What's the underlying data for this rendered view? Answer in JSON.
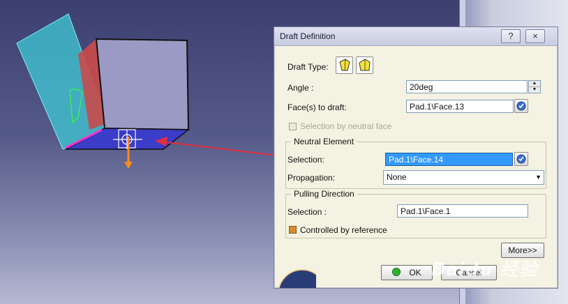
{
  "dialog": {
    "title": "Draft Definition",
    "help_label": "?",
    "close_label": "×",
    "draft_type_label": "Draft Type:",
    "angle_label": "Angle :",
    "angle_value": "20deg",
    "faces_label": "Face(s) to draft:",
    "faces_value": "Pad.1\\Face.13",
    "neutral_face_checkbox_label": "Selection by neutral face",
    "neutral_element": {
      "title": "Neutral Element",
      "selection_label": "Selection:",
      "selection_value": "Pad.1\\Face.14",
      "propagation_label": "Propagation:",
      "propagation_value": "None"
    },
    "pulling_direction": {
      "title": "Pulling Direction",
      "selection_label": "Selection :",
      "selection_value": "Pad.1\\Face.1",
      "controlled_label": "Controlled by reference"
    },
    "more_label": "More>>",
    "ok_label": "OK",
    "cancel_label": "Cancel"
  },
  "watermark": "Baidu 经验",
  "colors": {
    "plane_fill": "#3fc9d6",
    "cube_face": "#9a9ac4",
    "cube_bottom": "#3b3cc8",
    "draft_face": "#c94a4a",
    "arrow": "#e03040",
    "highlight_edge": "#ff33cc",
    "pull_arrow": "#ff8c1a"
  }
}
